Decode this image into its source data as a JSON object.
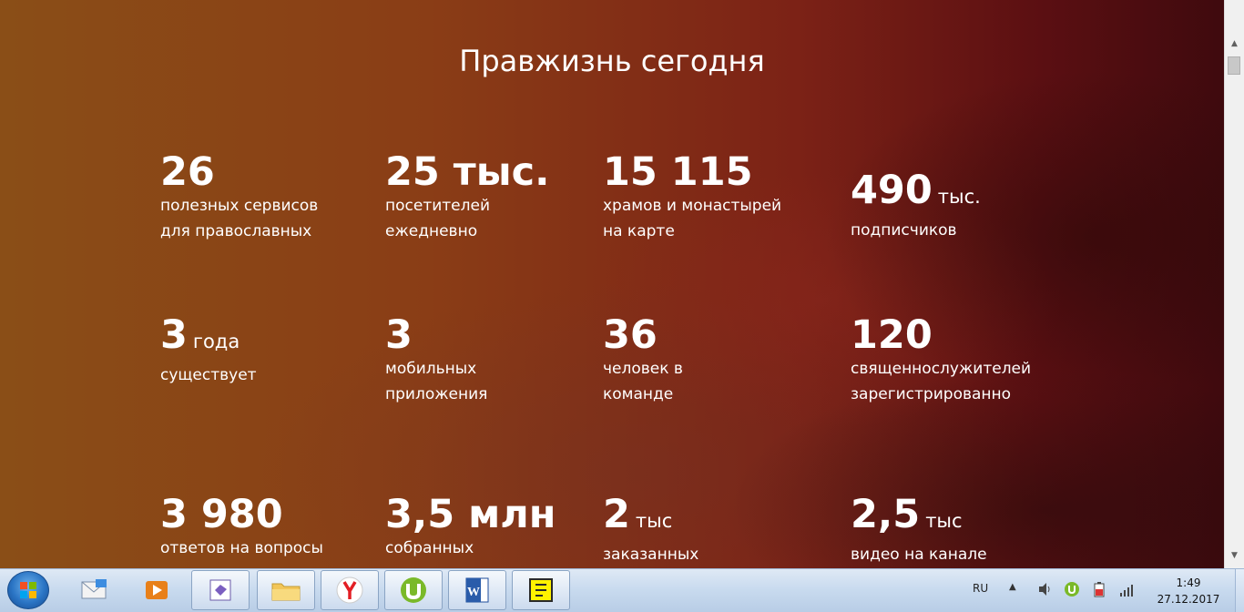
{
  "page": {
    "title": "Правжизнь сегодня"
  },
  "stats": [
    {
      "number": "26",
      "unit": "",
      "desc1": "полезных сервисов",
      "desc2": "для православных"
    },
    {
      "number": "25 тыс.",
      "unit": "",
      "desc1": "посетителей",
      "desc2": "ежедневно"
    },
    {
      "number": "15 115",
      "unit": "",
      "desc1": "храмов и монастырей",
      "desc2": "на карте"
    },
    {
      "number": "490",
      "unit": "тыс.",
      "desc1": "подписчиков",
      "desc2": ""
    },
    {
      "number": "3",
      "unit": "года",
      "desc1": "существует",
      "desc2": ""
    },
    {
      "number": "3",
      "unit": "",
      "desc1": "мобильных",
      "desc2": "приложения"
    },
    {
      "number": "36",
      "unit": "",
      "desc1": "человек в",
      "desc2": "команде"
    },
    {
      "number": "120",
      "unit": "",
      "desc1": "священнослужителей",
      "desc2": "зарегистрированно"
    },
    {
      "number": "3 980",
      "unit": "",
      "desc1": "ответов на вопросы",
      "desc2": ""
    },
    {
      "number": "3,5 млн",
      "unit": "",
      "desc1": "собранных",
      "desc2": ""
    },
    {
      "number": "2",
      "unit": "тыс",
      "desc1": "заказанных",
      "desc2": ""
    },
    {
      "number": "2,5",
      "unit": "тыс",
      "desc1": "видео на канале",
      "desc2": ""
    }
  ],
  "taskbar": {
    "apps": [
      {
        "name": "outlook-express",
        "icon": "mail-icon"
      },
      {
        "name": "media-player",
        "icon": "media-player-icon"
      },
      {
        "name": "visual-studio",
        "icon": "visual-studio-icon"
      },
      {
        "name": "explorer",
        "icon": "folder-icon"
      },
      {
        "name": "yandex-browser",
        "icon": "yandex-icon"
      },
      {
        "name": "utorrent",
        "icon": "utorrent-icon"
      },
      {
        "name": "word",
        "icon": "word-icon"
      },
      {
        "name": "sticky",
        "icon": "notes-icon"
      }
    ],
    "tray": {
      "language": "RU",
      "time": "1:49",
      "date": "27.12.2017"
    }
  },
  "colors": {
    "background_left": "#8a4e17",
    "background_right": "#3f0a0e",
    "text": "#ffffff",
    "taskbar": "#c9dbef"
  }
}
